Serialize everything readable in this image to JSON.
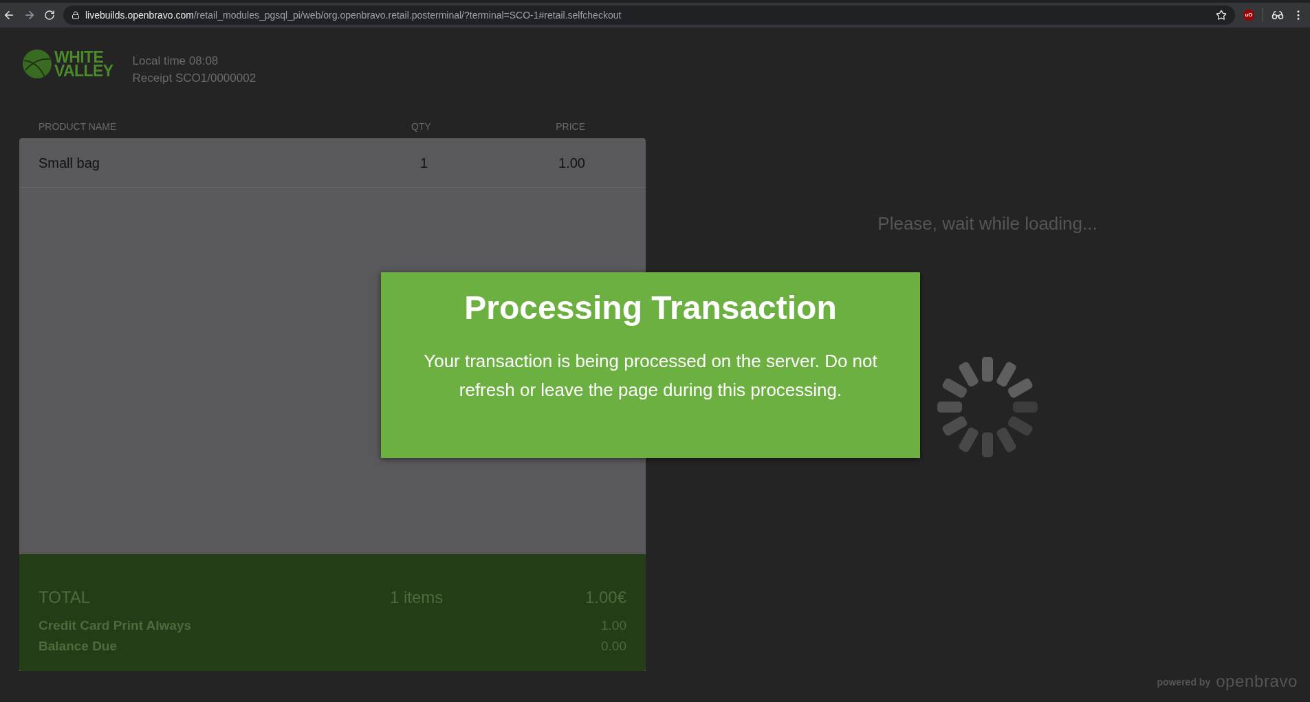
{
  "browser": {
    "url_host": "livebuilds.openbravo.com",
    "url_path": "/retail_modules_pgsql_pi/web/org.openbravo.retail.posterminal/?terminal=SCO-1#retail.selfcheckout",
    "extension_badge": "uO"
  },
  "header": {
    "logo_lines": [
      "WHITE",
      "VALLEY"
    ],
    "local_time": "Local time 08:08",
    "receipt": "Receipt SCO1/0000002"
  },
  "table": {
    "columns": [
      "PRODUCT NAME",
      "QTY",
      "PRICE"
    ],
    "rows": [
      {
        "name": "Small bag",
        "qty": "1",
        "price": "1.00"
      }
    ]
  },
  "totals": {
    "label": "TOTAL",
    "items": "1 items",
    "amount": "1.00€",
    "lines": [
      {
        "label": "Credit Card Print Always",
        "value": "1.00"
      },
      {
        "label": "Balance Due",
        "value": "0.00"
      }
    ]
  },
  "loading": "Please, wait while loading...",
  "dialog": {
    "title": "Processing Transaction",
    "message": "Your transaction is being processed on the server. Do not refresh or leave the page during this processing."
  },
  "footer": {
    "powered_by": "powered by",
    "brand": "openbravo"
  }
}
